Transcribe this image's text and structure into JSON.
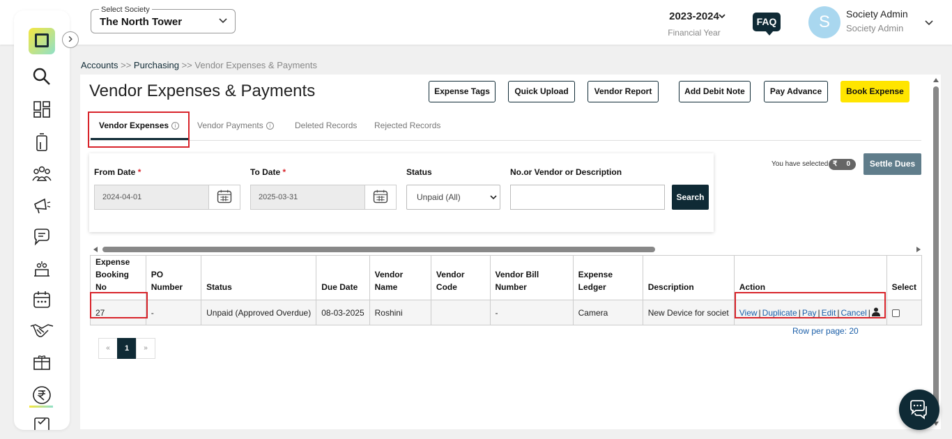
{
  "header": {
    "society_label": "Select Society",
    "society_value": "The North Tower",
    "financial_year": "2023-2024",
    "financial_year_label": "Financial Year",
    "faq": "FAQ",
    "avatar_initial": "S",
    "user_name": "Society Admin",
    "user_role": "Society Admin"
  },
  "sidebar": {
    "icons": [
      "search-icon",
      "dashboard-icon",
      "building-icon",
      "members-icon",
      "announcement-icon",
      "chat-icon",
      "facility-icon",
      "calendar-icon",
      "handshake-icon",
      "inventory-icon",
      "rupee-icon",
      "checklist-icon"
    ]
  },
  "breadcrumb": {
    "items": [
      "Accounts",
      "Purchasing",
      "Vendor Expenses & Payments"
    ],
    "separator": ">>"
  },
  "page": {
    "title": "Vendor Expenses & Payments",
    "buttons": [
      "Expense Tags",
      "Quick Upload",
      "Vendor Report",
      "Add Debit Note",
      "Pay Advance",
      "Book Expense"
    ],
    "tabs": [
      "Vendor Expenses",
      "Vendor Payments",
      "Deleted Records",
      "Rejected Records"
    ],
    "info_glyph": "i"
  },
  "filters": {
    "from_date_label": "From Date",
    "from_date_value": "2024-04-01",
    "to_date_label": "To Date",
    "to_date_value": "2025-03-31",
    "required_mark": "*",
    "status_label": "Status",
    "status_value": "Unpaid (All)",
    "search_label": "No.or Vendor or Description",
    "search_value": "",
    "search_button": "Search"
  },
  "selection": {
    "label": "You have selected",
    "currency": "₹",
    "count": "0",
    "settle_button": "Settle Dues"
  },
  "table": {
    "columns": [
      "Expense Booking No",
      "PO Number",
      "Status",
      "Due Date",
      "Vendor Name",
      "Vendor Code",
      "Vendor Bill Number",
      "Expense Ledger",
      "Description",
      "Action",
      "Select"
    ],
    "rows": [
      {
        "booking_no": "27",
        "po_number": "-",
        "status": "Unpaid (Approved Overdue)",
        "due_date": "08-03-2025",
        "vendor_name": "Roshini",
        "vendor_code": "",
        "vendor_bill_number": "-",
        "expense_ledger": "Camera",
        "description": "New Device for societ",
        "actions": [
          "View",
          "Duplicate",
          "Pay",
          "Edit",
          "Cancel"
        ],
        "action_sep": "|"
      }
    ]
  },
  "pagination": {
    "rows_per_page": "Row per page: 20",
    "prev": "«",
    "current": "1",
    "next": "»"
  },
  "colors": {
    "brand_dark": "#0f2a35",
    "accent_yellow": "#ffe500",
    "highlight_red": "#d8232a",
    "link_blue": "#1a5ea8"
  }
}
